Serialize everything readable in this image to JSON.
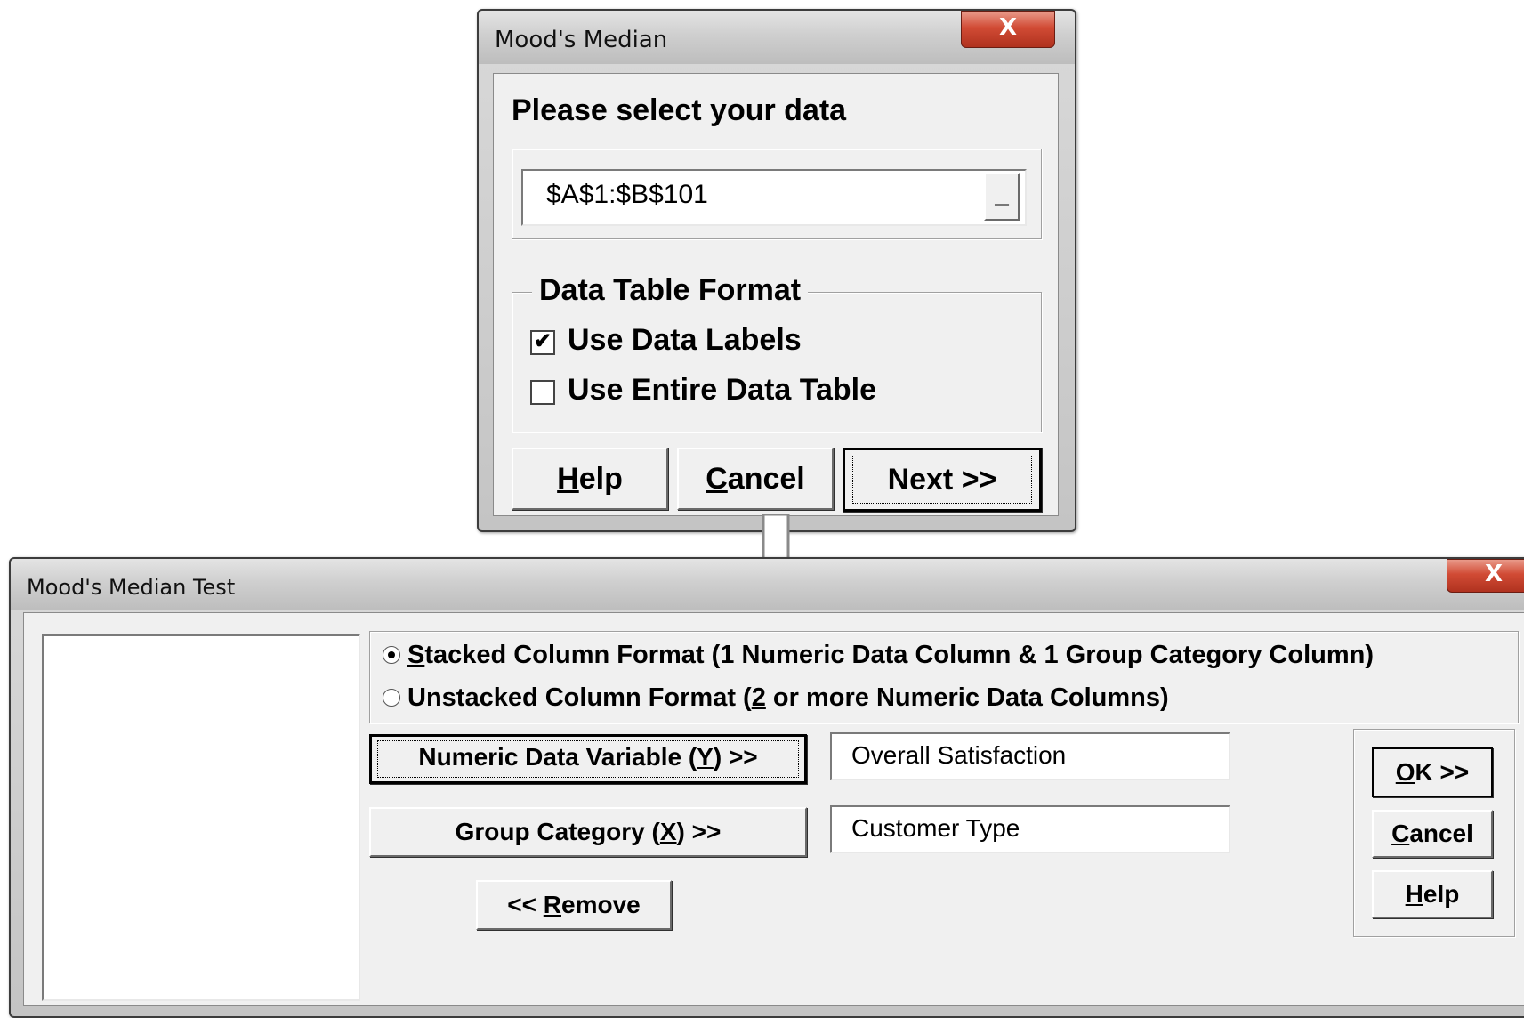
{
  "dialog1": {
    "title": "Mood's Median",
    "close_label": "X",
    "prompt": "Please select your data",
    "range_value": "$A$1:$B$101",
    "range_button_label": "_",
    "format_group": {
      "legend": "Data Table Format",
      "use_labels": {
        "label": "Use Data Labels",
        "checked": true,
        "mark": "✔"
      },
      "use_entire": {
        "label": "Use Entire Data Table",
        "checked": false,
        "mark": ""
      }
    },
    "buttons": {
      "help": {
        "mnemonic": "H",
        "rest": "elp"
      },
      "cancel": {
        "mnemonic": "C",
        "rest": "ancel"
      },
      "next": "Next >>"
    }
  },
  "dialog2": {
    "title": "Mood's Median Test",
    "close_label": "X",
    "format_options": {
      "stacked": {
        "mnemonic": "S",
        "rest": "tacked Column Format (1 Numeric Data Column & 1 Group Category Column)",
        "selected": true
      },
      "unstacked": {
        "pre": "Unstacked Column Format (",
        "mnemonic": "2",
        "post": " or more Numeric Data Columns)",
        "selected": false
      }
    },
    "numeric_button": {
      "pre": "Numeric Data Variable  (",
      "mnemonic": "Y",
      "post": ") >>"
    },
    "numeric_value": "Overall Satisfaction",
    "group_button": {
      "pre": "Group Category (",
      "mnemonic": "X",
      "post": ") >>"
    },
    "group_value": "Customer Type",
    "remove_button": {
      "pre": "<< ",
      "mnemonic": "R",
      "post": "emove"
    },
    "ok_button": {
      "mnemonic": "O",
      "rest": "K >>"
    },
    "cancel_button": {
      "mnemonic": "C",
      "rest": "ancel"
    },
    "help_button": {
      "mnemonic": "H",
      "rest": "elp"
    }
  },
  "connector": {
    "icon": "arrow-down-icon"
  }
}
